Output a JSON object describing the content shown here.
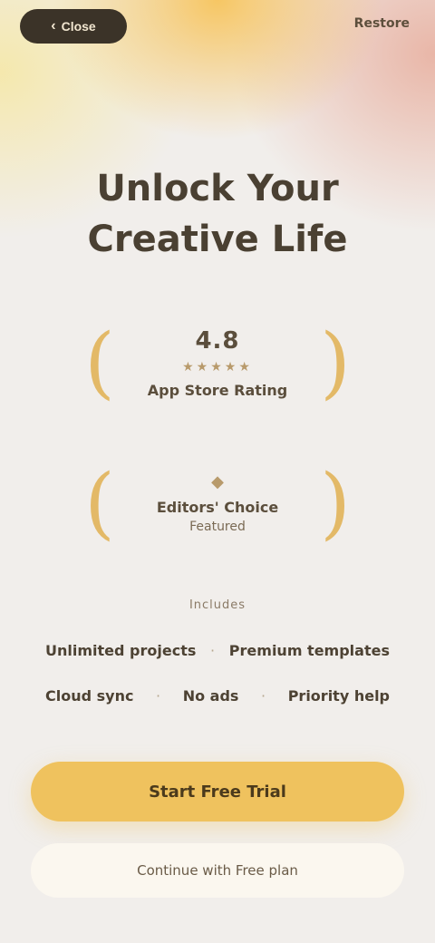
{
  "top_bar": {
    "back_label": "Close",
    "back_icon": "chevron-left-icon",
    "restore_label": "Restore"
  },
  "hero": {
    "title_line1": "Unlock Your",
    "title_line2": "Creative Life"
  },
  "awards": [
    {
      "big": "4.8",
      "stars": "★★★★★",
      "line": "App Store Rating",
      "sub": "",
      "icon": ""
    },
    {
      "big": "",
      "stars": "",
      "line": "Editors' Choice",
      "sub": "Featured",
      "icon": "◆"
    }
  ],
  "features": {
    "label": "Includes",
    "row1": [
      "Unlimited projects",
      "Premium templates"
    ],
    "row2": [
      "Cloud sync",
      "No ads",
      "Priority help"
    ]
  },
  "cta": {
    "primary_label": "Start Free Trial",
    "secondary_label": "Continue with Free plan"
  },
  "colors": {
    "accent": "#efc25e",
    "dark_pill": "#3b3328",
    "laurel": "#e3b967"
  }
}
